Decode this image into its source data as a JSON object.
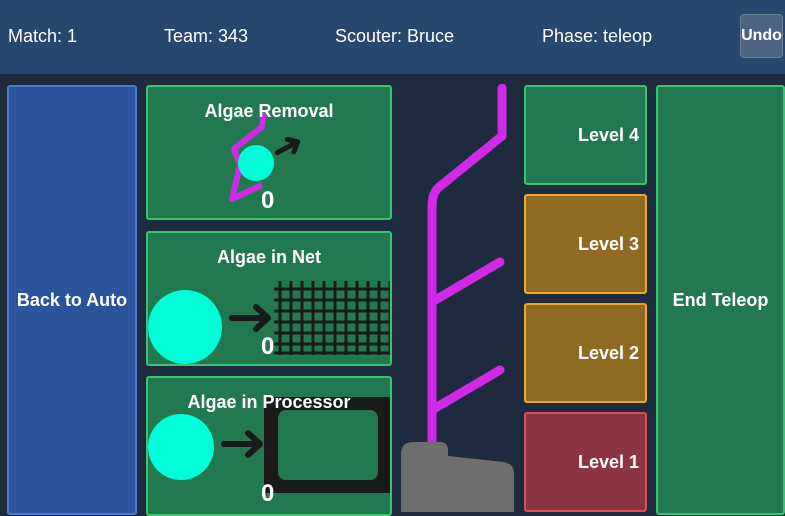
{
  "header": {
    "match": "Match: 1",
    "team": "Team: 343",
    "scouter": "Scouter: Bruce",
    "phase": "Phase: teleop",
    "undo_label": "Undo"
  },
  "buttons": {
    "back_to_auto": "Back to Auto",
    "end_teleop": "End Teleop"
  },
  "panels": [
    {
      "title": "Algae Removal",
      "count": "0"
    },
    {
      "title": "Algae in Net",
      "count": "0"
    },
    {
      "title": "Algae in Processor",
      "count": "0"
    }
  ],
  "levels": [
    {
      "label": "Level 4",
      "status": "green"
    },
    {
      "label": "Level 3",
      "status": "orange"
    },
    {
      "label": "Level 2",
      "status": "orange"
    },
    {
      "label": "Level 1",
      "status": "red"
    }
  ],
  "colors": {
    "header_bg": "#29476e",
    "background": "#1e2a3d",
    "panel_green": "#22794f",
    "panel_border_green": "#36c570",
    "blue_button": "#2b549b",
    "orange_level": "#8f6a23",
    "red_level": "#8b3541",
    "algae": "#00ffd8",
    "reef_branch": "#d02ae8"
  },
  "icons": [
    "algae-ball-icon",
    "arrow-right-icon",
    "net-grid-icon",
    "processor-icon",
    "reef-branch-icon",
    "reef-base-icon"
  ]
}
